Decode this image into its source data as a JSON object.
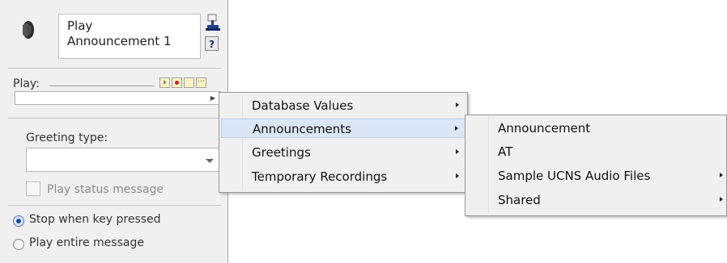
{
  "panel": {
    "title_line1": "Play",
    "title_line2": "Announcement 1",
    "help_glyph": "?",
    "play_label": "Play:",
    "greeting_type_label": "Greeting type:",
    "greeting_type_value": "",
    "play_status_label": "Play status message",
    "play_status_checked": false,
    "radio_options": [
      {
        "label": "Stop when key pressed",
        "selected": true
      },
      {
        "label": "Play entire message",
        "selected": false
      }
    ]
  },
  "menu_primary": {
    "items": [
      {
        "label": "Database Values",
        "submenu": true,
        "highlighted": false
      },
      {
        "label": "Announcements",
        "submenu": true,
        "highlighted": true
      },
      {
        "label": "Greetings",
        "submenu": true,
        "highlighted": false
      },
      {
        "label": "Temporary Recordings",
        "submenu": true,
        "highlighted": false
      }
    ]
  },
  "menu_announcements": {
    "items": [
      {
        "label": "Announcement",
        "submenu": false
      },
      {
        "label": "AT",
        "submenu": false
      },
      {
        "label": "Sample UCNS Audio Files",
        "submenu": true
      },
      {
        "label": "Shared",
        "submenu": true
      }
    ]
  },
  "icons": {
    "speaker": "speaker-icon",
    "tool": "properties-tool-icon",
    "help": "help-icon",
    "play_toolbar": [
      "play-icon",
      "record-icon",
      "stop-icon",
      "browse-ellipsis-icon"
    ],
    "dropdown": "chevron-down-icon",
    "submenu": "chevron-right-icon"
  },
  "colors": {
    "panel_bg": "#f0f0f0",
    "menu_bg": "#f0f0f0",
    "highlight": "#dbe7f7",
    "record_red": "#d21a1a",
    "radio_selected": "#1d4fa0"
  }
}
